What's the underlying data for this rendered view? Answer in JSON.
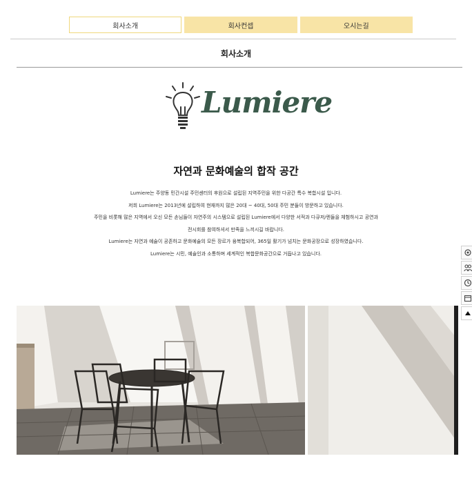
{
  "nav": {
    "tabs": [
      {
        "label": "회사소개",
        "active": true
      },
      {
        "label": "회사컨셉",
        "active": false
      },
      {
        "label": "오시는길",
        "active": false
      }
    ]
  },
  "page": {
    "title": "회사소개"
  },
  "brand": {
    "logo_text": "Lumiere",
    "logo_color": "#3b5a4b",
    "logo_icon": "lightbulb-icon"
  },
  "intro": {
    "headline": "자연과 문화예술의 합작 공간",
    "lines": [
      "Lumiere는 주양동 민간시설 주민센터의 후원으로 설립된 지역주민을 위한 다공간 특수 복합시설 입니다.",
      "저희 Lumiere는 2013년에 설립하여 현재까지 많은 20대 ~ 40대, 50대 주민 분들이 방문하고 있습니다.",
      "주민을 비롯해 많은 지역에서 오신 모든 손님들이 자연주의 시스템으로 설립된 Lumiere에서 다양한 서적과 다큐저/렌들을 체험하시고 공연과",
      "전시회를 참여하셔서 만족을 느끼시길 바랍니다.",
      "Lumiere는 자연과 예술이 공존하고 문화예술의 모든 장르가 융복합되어, 365일 활기가 넘치는 문화공장으로 성장하였습니다.",
      "Lumiere는 시민, 예술인과 소통하며 세계적인 복합문화공간으로 거듭나고 있습니다."
    ]
  },
  "side_toolbar": {
    "icons": [
      "settings-icon",
      "people-icon",
      "clock-icon",
      "calendar-icon",
      "arrow-up-icon"
    ]
  },
  "colors": {
    "tab_bg": "#f8e4a6",
    "tab_active_border": "#efd77c"
  }
}
